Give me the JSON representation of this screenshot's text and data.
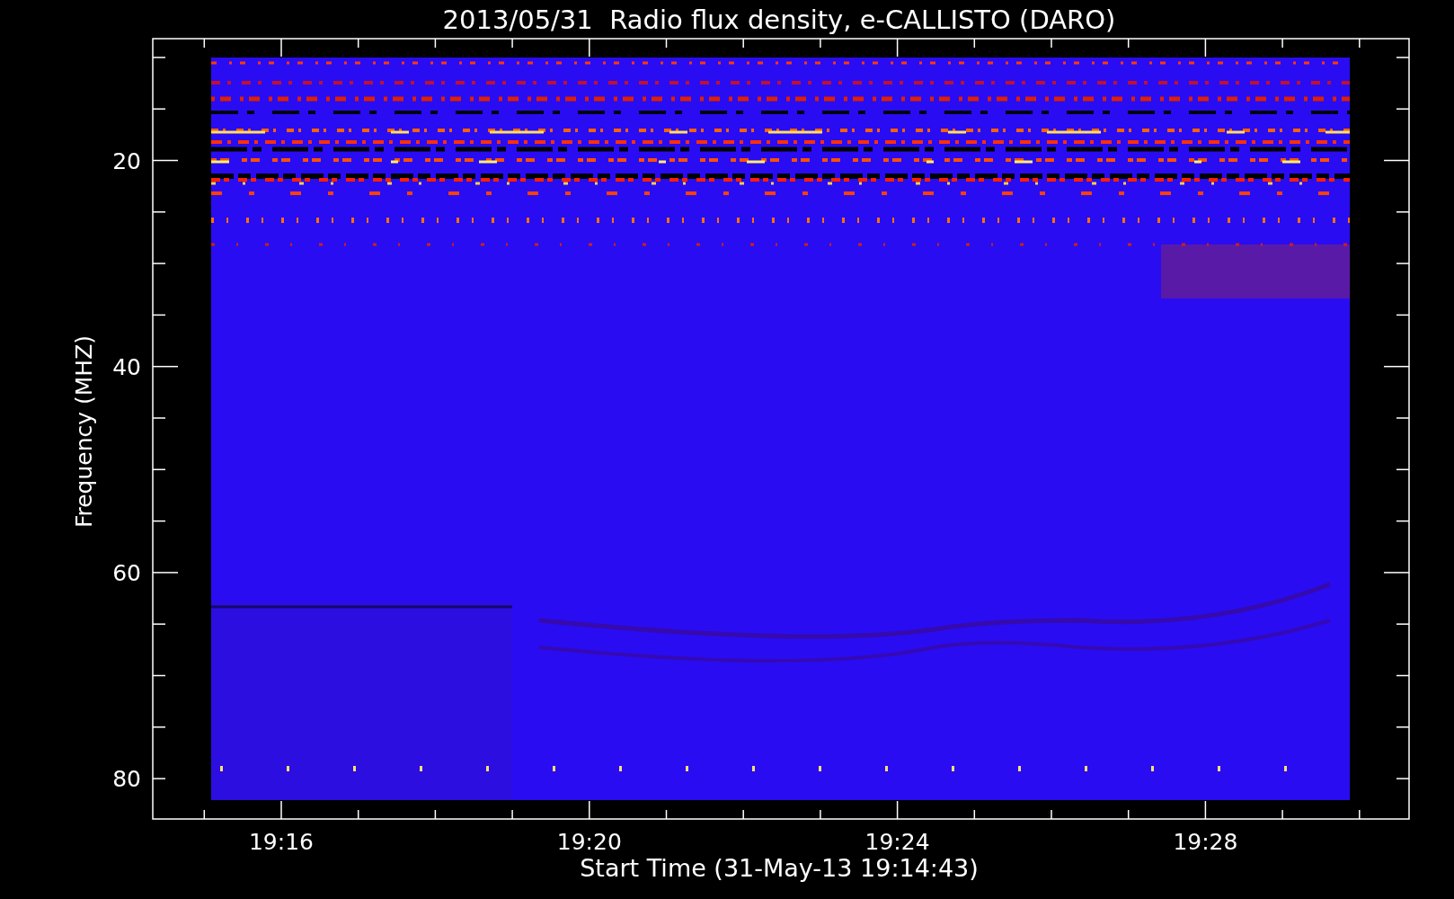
{
  "title": "2013/05/31  Radio flux density, e-CALLISTO (DARO)",
  "y_axis": {
    "label": "Frequency (MHZ)",
    "ticks": [
      "20",
      "40",
      "60",
      "80"
    ]
  },
  "x_axis": {
    "label": "Start Time (31-May-13 19:14:43)",
    "ticks": [
      "19:16",
      "19:20",
      "19:24",
      "19:28"
    ]
  }
}
